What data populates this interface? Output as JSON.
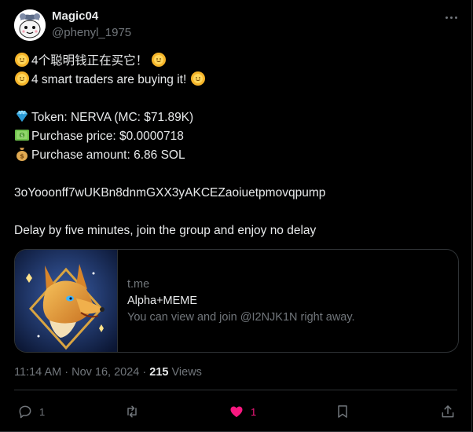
{
  "author": {
    "display_name": "Magic04",
    "handle": "@phenyl_1975",
    "avatar_icon": "cartoon-avatar"
  },
  "tweet": {
    "lines": [
      {
        "emoji": "sun-emoji",
        "text": "4个聪明钱正在买它！",
        "trailing_emoji": "sun-emoji"
      },
      {
        "emoji": "sun-emoji",
        "text": "4 smart traders are buying it! ",
        "trailing_emoji": "sun-emoji"
      },
      {
        "emoji": "diamond-emoji",
        "text": "Token: NERVA (MC: $71.89K)"
      },
      {
        "emoji": "dollar-banknote-emoji",
        "text": "Purchase price: $0.0000718"
      },
      {
        "emoji": "money-bag-emoji",
        "text": "Purchase amount: 6.86 SOL"
      },
      {
        "text": "3oYooonff7wUKBn8dnmGXX3yAKCEZaoiuetpmovqpump"
      },
      {
        "text": "Delay by five minutes, join the group and enjoy no delay"
      }
    ]
  },
  "card": {
    "domain": "t.me",
    "title": "Alpha+MEME",
    "description": "You can view and join @I2NJK1N right away.",
    "image_icon": "wolf-artwork"
  },
  "meta": {
    "time": "11:14 AM",
    "separator": "·",
    "date": "Nov 16, 2024",
    "views_count": "215",
    "views_label": "Views"
  },
  "actions": {
    "reply_count": "1",
    "retweet_count": "",
    "like_count": "1",
    "like_color": "#f91880"
  },
  "colors": {
    "background": "#000000",
    "text": "#e7e9ea",
    "secondary": "#71767b",
    "border": "#2f3336"
  }
}
